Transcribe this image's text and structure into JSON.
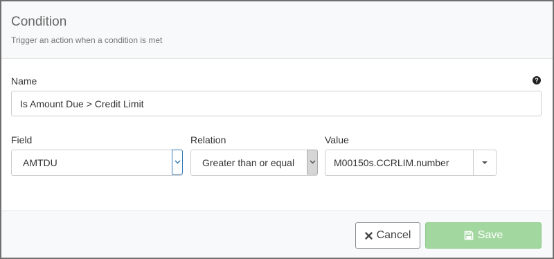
{
  "dialog": {
    "title": "Condition",
    "subtitle": "Trigger an action when a condition is met"
  },
  "name_field": {
    "label": "Name",
    "value": "Is Amount Due > Credit Limit",
    "help_icon": "question-circle-icon"
  },
  "field_select": {
    "label": "Field",
    "value": "AMTDU",
    "icon": "chevron-down-icon"
  },
  "relation_select": {
    "label": "Relation",
    "value": "Greater than or equal",
    "icon": "chevron-down-icon"
  },
  "value_combo": {
    "label": "Value",
    "value": "M00150s.CCRLIM.number",
    "icon": "caret-down-icon"
  },
  "footer": {
    "cancel_label": "Cancel",
    "cancel_icon": "times-icon",
    "save_label": "Save",
    "save_icon": "floppy-disk-icon"
  },
  "colors": {
    "header_bg": "#f8f9fa",
    "focus_border": "#337ab7",
    "save_disabled_bg": "#a3d7a0"
  }
}
